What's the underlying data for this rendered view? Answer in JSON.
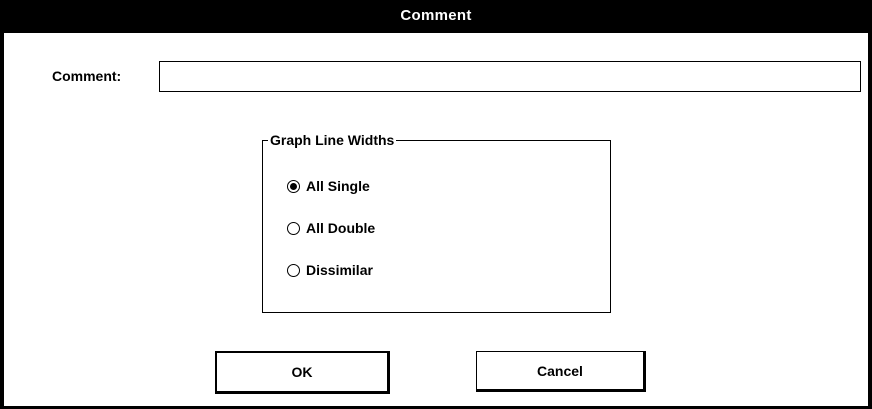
{
  "window": {
    "title": "Comment"
  },
  "comment_field": {
    "label": "Comment:",
    "value": "",
    "placeholder": ""
  },
  "line_widths_group": {
    "title": "Graph Line Widths",
    "options": [
      {
        "label": "All Single",
        "selected": true
      },
      {
        "label": "All Double",
        "selected": false
      },
      {
        "label": "Dissimilar",
        "selected": false
      }
    ]
  },
  "buttons": {
    "ok_label": "OK",
    "cancel_label": "Cancel"
  }
}
